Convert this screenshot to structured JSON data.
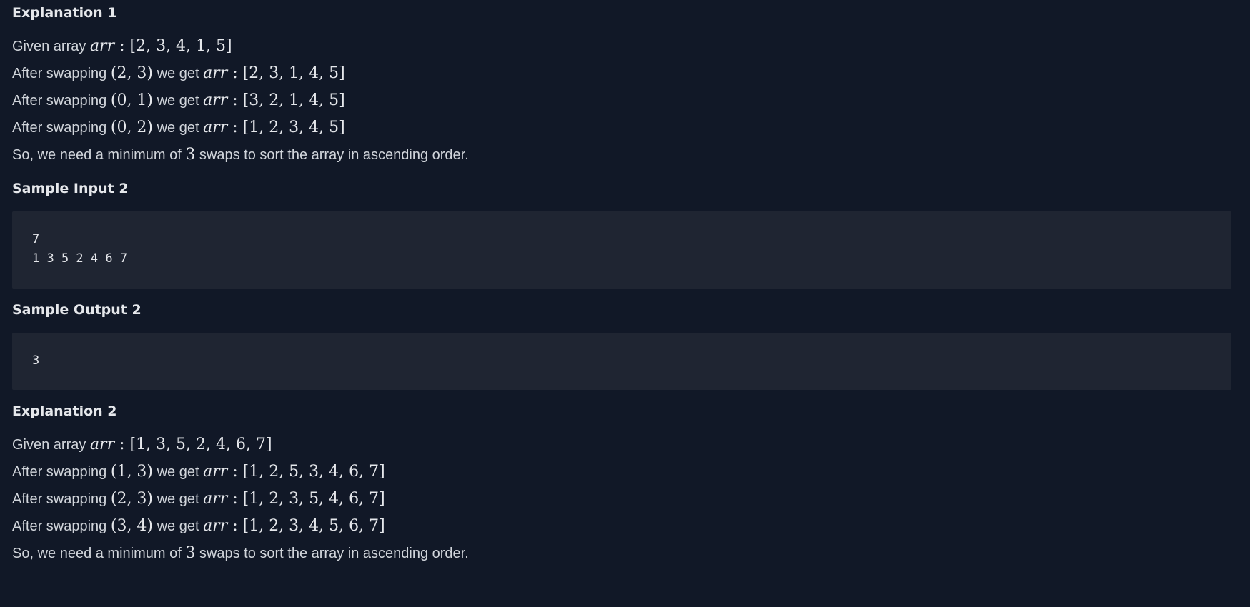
{
  "explanation1": {
    "title": "Explanation 1",
    "given": {
      "prefix": "Given array ",
      "var": "arr",
      "sep": " : ",
      "array": "[2, 3, 4, 1, 5]"
    },
    "steps": [
      {
        "prefix": "After swapping ",
        "pair": "(2, 3)",
        "mid": " we get ",
        "var": "arr",
        "sep": " : ",
        "array": "[2, 3, 1, 4, 5]"
      },
      {
        "prefix": "After swapping ",
        "pair": "(0, 1)",
        "mid": " we get ",
        "var": "arr",
        "sep": " : ",
        "array": "[3, 2, 1, 4, 5]"
      },
      {
        "prefix": "After swapping ",
        "pair": "(0, 2)",
        "mid": " we get ",
        "var": "arr",
        "sep": " : ",
        "array": "[1, 2, 3, 4, 5]"
      }
    ],
    "conclusion": {
      "prefix": "So, we need a minimum of ",
      "num": "3",
      "suffix": " swaps to sort the array in ascending order."
    }
  },
  "sample_input2": {
    "title": "Sample Input 2",
    "lines": [
      "7",
      "1 3 5 2 4 6 7"
    ]
  },
  "sample_output2": {
    "title": "Sample Output 2",
    "lines": [
      "3"
    ]
  },
  "explanation2": {
    "title": "Explanation 2",
    "given": {
      "prefix": "Given array ",
      "var": "arr",
      "sep": " : ",
      "array": "[1, 3, 5, 2, 4, 6, 7]"
    },
    "steps": [
      {
        "prefix": "After swapping ",
        "pair": "(1, 3)",
        "mid": " we get ",
        "var": "arr",
        "sep": " : ",
        "array": "[1, 2, 5, 3, 4, 6, 7]"
      },
      {
        "prefix": "After swapping ",
        "pair": "(2, 3)",
        "mid": " we get ",
        "var": "arr",
        "sep": " : ",
        "array": "[1, 2, 3, 5, 4, 6, 7]"
      },
      {
        "prefix": "After swapping ",
        "pair": "(3, 4)",
        "mid": " we get ",
        "var": "arr",
        "sep": " : ",
        "array": "[1, 2, 3, 4, 5, 6, 7]"
      }
    ],
    "conclusion": {
      "prefix": "So, we need a minimum of ",
      "num": "3",
      "suffix": " swaps to sort the array in ascending order."
    }
  }
}
